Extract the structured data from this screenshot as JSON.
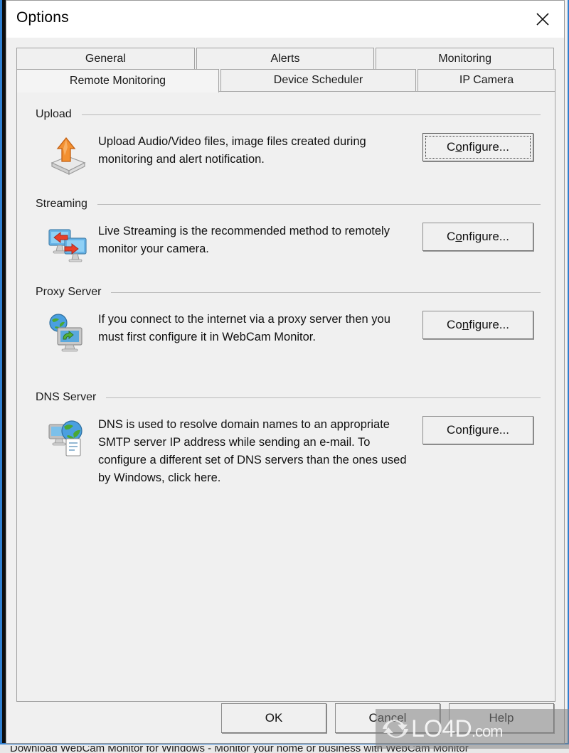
{
  "window": {
    "title": "Options",
    "close_icon": "close-x-icon"
  },
  "tabs": {
    "row1": [
      {
        "label": "General",
        "selected": false
      },
      {
        "label": "Alerts",
        "selected": false
      },
      {
        "label": "Monitoring",
        "selected": false
      }
    ],
    "row2": [
      {
        "label": "Remote Monitoring",
        "selected": true
      },
      {
        "label": "Device Scheduler",
        "selected": false
      },
      {
        "label": "IP Camera",
        "selected": false
      }
    ]
  },
  "sections": [
    {
      "title": "Upload",
      "icon": "upload-tray-icon",
      "description": "Upload Audio/Video files, image files created during monitoring and alert notification.",
      "button": {
        "pre": "C",
        "acc": "o",
        "post": "nfigure...",
        "focused": true
      }
    },
    {
      "title": "Streaming",
      "icon": "two-monitors-streaming-icon",
      "description": "Live Streaming is the recommended method to remotely monitor your camera.",
      "button": {
        "pre": "C",
        "acc": "o",
        "post": "nfigure...",
        "focused": false
      }
    },
    {
      "title": "Proxy Server",
      "icon": "globe-monitor-proxy-icon",
      "description": "If you connect to the internet via a proxy server then you must first configure it in WebCam Monitor.",
      "button": {
        "pre": "Co",
        "acc": "n",
        "post": "figure...",
        "focused": false
      }
    },
    {
      "title": "DNS Server",
      "icon": "globe-document-dns-icon",
      "description": "DNS is used to resolve domain names to an appropriate SMTP server IP address while sending an e-mail. To configure a different set of DNS servers than the ones used by Windows, click here.",
      "button": {
        "pre": "Con",
        "acc": "f",
        "post": "igure...",
        "focused": false
      }
    }
  ],
  "footer": {
    "ok": "OK",
    "cancel": "Cancel",
    "help": "Help"
  },
  "watermark": {
    "name": "LO4D",
    "suffix": ".com"
  },
  "bottom_peek": "Download WebCam Monitor for Windows - Monitor your home or business with WebCam Monitor",
  "colors": {
    "dialog_bg": "#f0f0f0",
    "titlebar_bg": "#ffffff",
    "accent_blue": "#2f7fd0",
    "border": "#a0a0a0",
    "text": "#101010",
    "upload_orange": "#f08020",
    "monitor_blue": "#4a9fe0",
    "globe_green": "#4aa834"
  }
}
